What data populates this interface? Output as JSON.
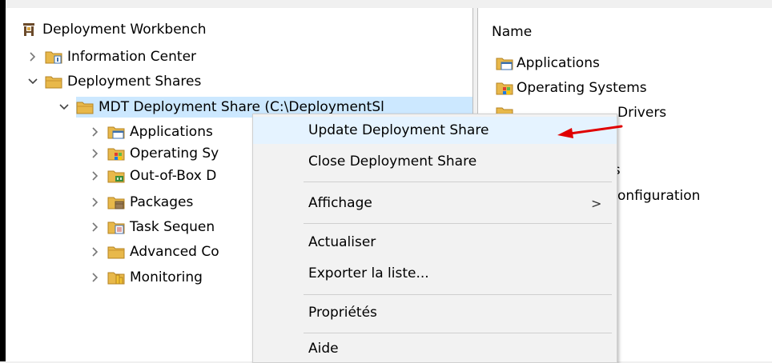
{
  "tree": {
    "root_label": "Deployment Workbench",
    "nodes": [
      {
        "label": "Information Center",
        "icon": "info-folder-icon",
        "expanded": false
      },
      {
        "label": "Deployment Shares",
        "icon": "folder-icon",
        "expanded": true
      },
      {
        "label": "MDT Deployment Share (C:\\DeploymentSl",
        "icon": "folder-icon",
        "expanded": true,
        "selected": true
      }
    ],
    "children": [
      {
        "label": "Applications",
        "icon": "applications-folder-icon"
      },
      {
        "label": "Operating Sy",
        "icon": "operating-systems-folder-icon"
      },
      {
        "label": "Out-of-Box D",
        "icon": "drivers-folder-icon"
      },
      {
        "label": "Packages",
        "icon": "packages-folder-icon"
      },
      {
        "label": "Task Sequen",
        "icon": "task-sequences-folder-icon"
      },
      {
        "label": "Advanced Co",
        "icon": "folder-icon"
      },
      {
        "label": "Monitoring",
        "icon": "monitoring-folder-icon"
      }
    ]
  },
  "list": {
    "column_header": "Name",
    "items": [
      {
        "label": "Applications",
        "icon": "applications-folder-icon"
      },
      {
        "label": "Operating Systems",
        "icon": "operating-systems-folder-icon"
      },
      {
        "label": "Drivers",
        "icon": "folder-icon"
      },
      {
        "label": "ces",
        "icon": ""
      },
      {
        "label": "onfiguration",
        "icon": ""
      }
    ]
  },
  "context_menu": {
    "items": [
      {
        "label": "Update Deployment Share",
        "hover": true
      },
      {
        "label": "Close Deployment Share"
      },
      {
        "label": "Affichage",
        "submenu_glyph": ">"
      },
      {
        "label": "Actualiser"
      },
      {
        "label": "Exporter la liste..."
      },
      {
        "label": "Propriétés"
      },
      {
        "label": "Aide"
      }
    ]
  },
  "colors": {
    "selection": "#cce8ff",
    "menu_hover": "#e5f3ff",
    "annotation_arrow": "#e00000",
    "folder": "#e8b84a"
  }
}
